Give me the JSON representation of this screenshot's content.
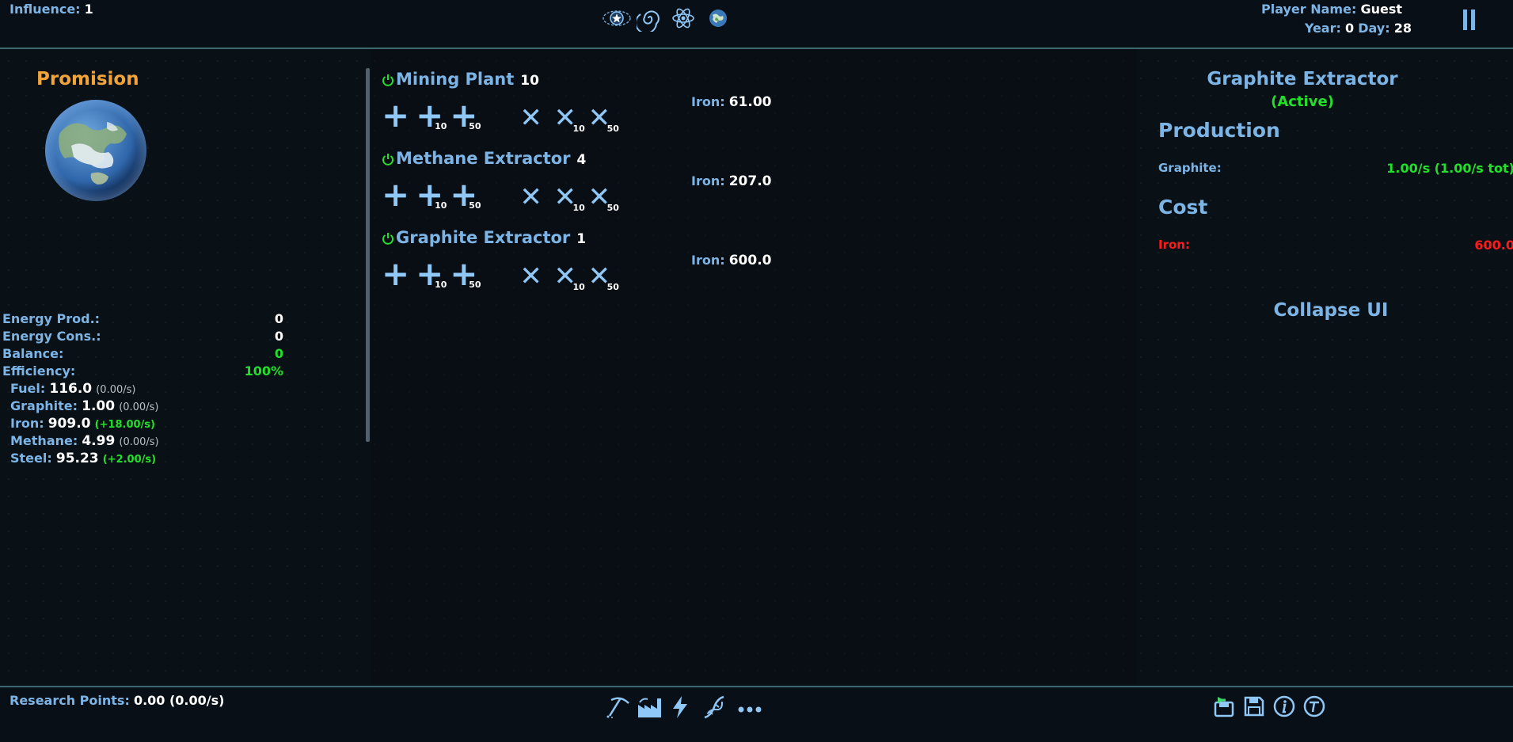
{
  "top": {
    "influence_label": "Influence:",
    "influence_value": "1",
    "player_label": "Player Name:",
    "player_value": "Guest",
    "date_label": "Year:",
    "year_value": "0",
    "day_label": "Day:",
    "day_value": "28",
    "nav_icons": [
      "galaxy-star-icon",
      "spiral-galaxy-icon",
      "atom-icon",
      "planet-icon"
    ],
    "pause_icon": "pause-icon"
  },
  "planet": {
    "name": "Promision",
    "energy": [
      {
        "label": "Energy Prod.:",
        "value": "0",
        "color": "#ffffff"
      },
      {
        "label": "Energy Cons.:",
        "value": "0",
        "color": "#ffffff"
      },
      {
        "label": "Balance:",
        "value": "0",
        "color": "#22e02a"
      },
      {
        "label": "Efficiency:",
        "value": "100%",
        "color": "#22e02a"
      }
    ],
    "resources": [
      {
        "name": "Fuel:",
        "amount": "116.0",
        "rate": "(0.00/s)",
        "rate_color": "#b9c1c8"
      },
      {
        "name": "Graphite:",
        "amount": "1.00",
        "rate": "(0.00/s)",
        "rate_color": "#b9c1c8"
      },
      {
        "name": "Iron:",
        "amount": "909.0",
        "rate": "(+18.00/s)",
        "rate_color": "#22e02a"
      },
      {
        "name": "Methane:",
        "amount": "4.99",
        "rate": "(0.00/s)",
        "rate_color": "#b9c1c8"
      },
      {
        "name": "Steel:",
        "amount": "95.23",
        "rate": "(+2.00/s)",
        "rate_color": "#22e02a"
      }
    ]
  },
  "buildings": [
    {
      "name": "Mining Plant",
      "count": "10",
      "cost_label": "Iron:",
      "cost_value": "61.00"
    },
    {
      "name": "Methane Extractor",
      "count": "4",
      "cost_label": "Iron:",
      "cost_value": "207.0"
    },
    {
      "name": "Graphite Extractor",
      "count": "1",
      "cost_label": "Iron:",
      "cost_value": "600.0"
    }
  ],
  "actions": {
    "add_subs": [
      "",
      "10",
      "50"
    ],
    "remove_subs": [
      "",
      "10",
      "50"
    ]
  },
  "details": {
    "title": "Graphite Extractor",
    "status": "(Active)",
    "production_heading": "Production",
    "production_label": "Graphite:",
    "production_value": "1.00/s (1.00/s tot)",
    "cost_heading": "Cost",
    "cost_label": "Iron:",
    "cost_value": "600.0",
    "collapse_label": "Collapse UI"
  },
  "bottom": {
    "research_label": "Research Points:",
    "research_value": "0.00 (0.00/s)",
    "nav_icons": [
      "pickaxe-icon",
      "factory-icon",
      "lightning-icon",
      "dna-icon",
      "more-icon"
    ],
    "system_icons": [
      "load-icon",
      "save-icon",
      "info-icon",
      "tutorial-icon"
    ]
  }
}
